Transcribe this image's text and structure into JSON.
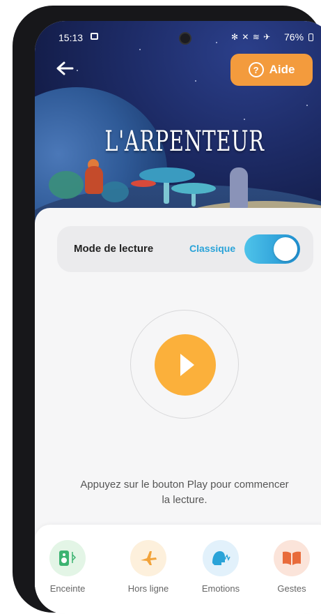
{
  "status": {
    "time": "15:13",
    "icons": "✻ ✕ ≋ ✈",
    "battery": "76%"
  },
  "header": {
    "back_icon": "arrow-left-icon",
    "help_label": "Aide",
    "help_icon": "?",
    "title": "L'ARPENTEUR"
  },
  "mode": {
    "label": "Mode de lecture",
    "value": "Classique",
    "toggle_on": true
  },
  "player": {
    "hint": "Appuyez sur le bouton Play pour commencer la lecture."
  },
  "nav": {
    "items": [
      {
        "label": "Enceinte",
        "icon": "speaker-icon",
        "glyph": "▣",
        "color": "#3cb371",
        "bg": "#e3f5e6"
      },
      {
        "label": "Hors ligne",
        "icon": "airplane-icon",
        "glyph": "✈",
        "color": "#f2a33a",
        "bg": "#fdf0dc"
      },
      {
        "label": "Emotions",
        "icon": "voice-icon",
        "glyph": "◉",
        "color": "#2aa3d8",
        "bg": "#e2f1fb"
      },
      {
        "label": "Gestes",
        "icon": "book-icon",
        "glyph": "▦",
        "color": "#e86b3b",
        "bg": "#fbe4da"
      }
    ]
  },
  "colors": {
    "accent_orange": "#fbb03b",
    "help_orange": "#f39b3d",
    "toggle_blue": "#2aa3d8"
  }
}
